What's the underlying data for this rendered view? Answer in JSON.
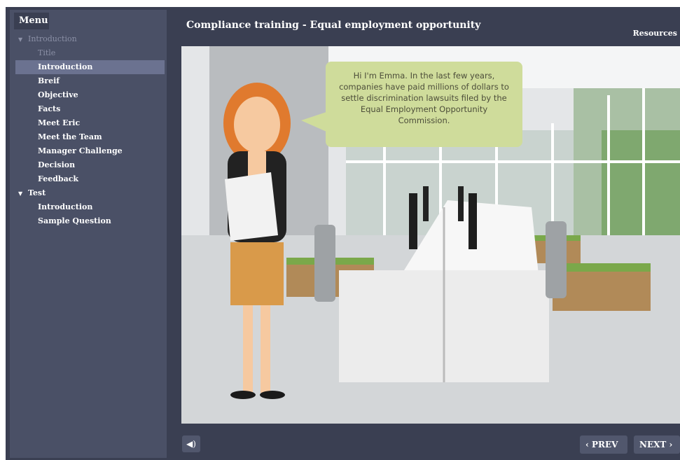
{
  "sidebar": {
    "menu_label": "Menu",
    "items": [
      {
        "label": "Introduction",
        "kind": "section",
        "state": "dim",
        "caret": "▼"
      },
      {
        "label": "Title",
        "kind": "child",
        "state": "dim"
      },
      {
        "label": "Introduction",
        "kind": "child",
        "state": "active"
      },
      {
        "label": "Breif",
        "kind": "child",
        "state": "normal"
      },
      {
        "label": "Objective",
        "kind": "child",
        "state": "normal"
      },
      {
        "label": "Facts",
        "kind": "child",
        "state": "normal"
      },
      {
        "label": "Meet Eric",
        "kind": "child",
        "state": "normal"
      },
      {
        "label": "Meet the Team",
        "kind": "child",
        "state": "normal"
      },
      {
        "label": "Manager Challenge",
        "kind": "child",
        "state": "normal"
      },
      {
        "label": "Decision",
        "kind": "child",
        "state": "normal"
      },
      {
        "label": "Feedback",
        "kind": "child",
        "state": "normal"
      },
      {
        "label": "Test",
        "kind": "section",
        "state": "normal",
        "caret": "▼"
      },
      {
        "label": "Introduction",
        "kind": "child",
        "state": "normal"
      },
      {
        "label": "Sample Question",
        "kind": "child",
        "state": "normal"
      }
    ]
  },
  "header": {
    "title": "Compliance training - Equal employment opportunity",
    "resources_label": "Resources"
  },
  "slide": {
    "speech": "Hi I'm Emma. In the last few years, companies have paid millions of dollars to settle discrimination lawsuits filed by the Equal Employment Opportunity Commission."
  },
  "footer": {
    "audio_icon": "speaker-icon",
    "prev_label": "‹ PREV",
    "next_label": "NEXT ›"
  },
  "colors": {
    "frame": "#3a3f52",
    "sidebar": "#4a5066",
    "active_item": "#6b7290",
    "bubble": "#cfdc9b"
  }
}
